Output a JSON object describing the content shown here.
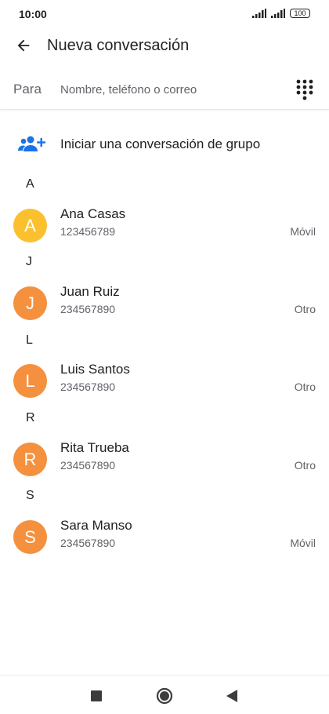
{
  "status_bar": {
    "time": "10:00",
    "battery": "100",
    "icons": [
      "signal-icon",
      "signal-icon",
      "battery-icon"
    ]
  },
  "app_bar": {
    "title": "Nueva conversación",
    "back_icon": "arrow-back-icon"
  },
  "to_field": {
    "label": "Para",
    "placeholder": "Nombre, teléfono o correo",
    "value": "",
    "dialpad_icon": "dialpad-icon"
  },
  "group": {
    "label": "Iniciar una conversación de grupo",
    "icon": "group-add-icon"
  },
  "contacts": [
    {
      "letter": "A",
      "initial": "A",
      "name": "Ana Casas",
      "phone": "123456789",
      "type": "Móvil",
      "color": "#FBC02D"
    },
    {
      "letter": "J",
      "initial": "J",
      "name": "Juan Ruiz",
      "phone": "234567890",
      "type": "Otro",
      "color": "#F5903E"
    },
    {
      "letter": "L",
      "initial": "L",
      "name": "Luis Santos",
      "phone": "234567890",
      "type": "Otro",
      "color": "#F5903E"
    },
    {
      "letter": "R",
      "initial": "R",
      "name": "Rita Trueba",
      "phone": "234567890",
      "type": "Otro",
      "color": "#F5903E"
    },
    {
      "letter": "S",
      "initial": "S",
      "name": "Sara Manso",
      "phone": "234567890",
      "type": "Móvil",
      "color": "#F5903E"
    }
  ],
  "colors": {
    "accent": "#1A73E8",
    "text_primary": "#202124",
    "text_secondary": "#5F6368"
  },
  "nav_bar": {
    "icons": [
      "recents-square-icon",
      "home-circle-icon",
      "back-triangle-icon"
    ]
  }
}
